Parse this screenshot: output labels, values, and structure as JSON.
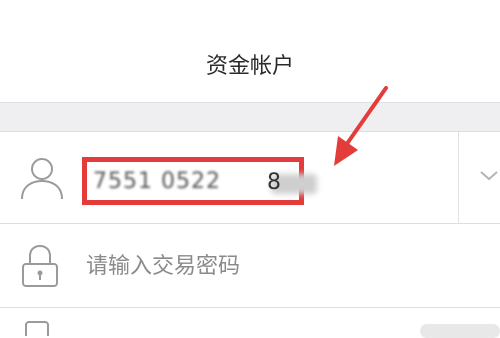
{
  "header": {
    "title": "资金帐户"
  },
  "account": {
    "value": "7551 0522 ",
    "tail": "8",
    "icon": "user-icon",
    "dropdown_icon": "chevron-down-icon"
  },
  "password": {
    "placeholder": "请输入交易密码",
    "icon": "lock-icon"
  },
  "colors": {
    "highlight": "#e43b3b",
    "gap": "#efeff1",
    "placeholder": "#8a8a8a"
  }
}
